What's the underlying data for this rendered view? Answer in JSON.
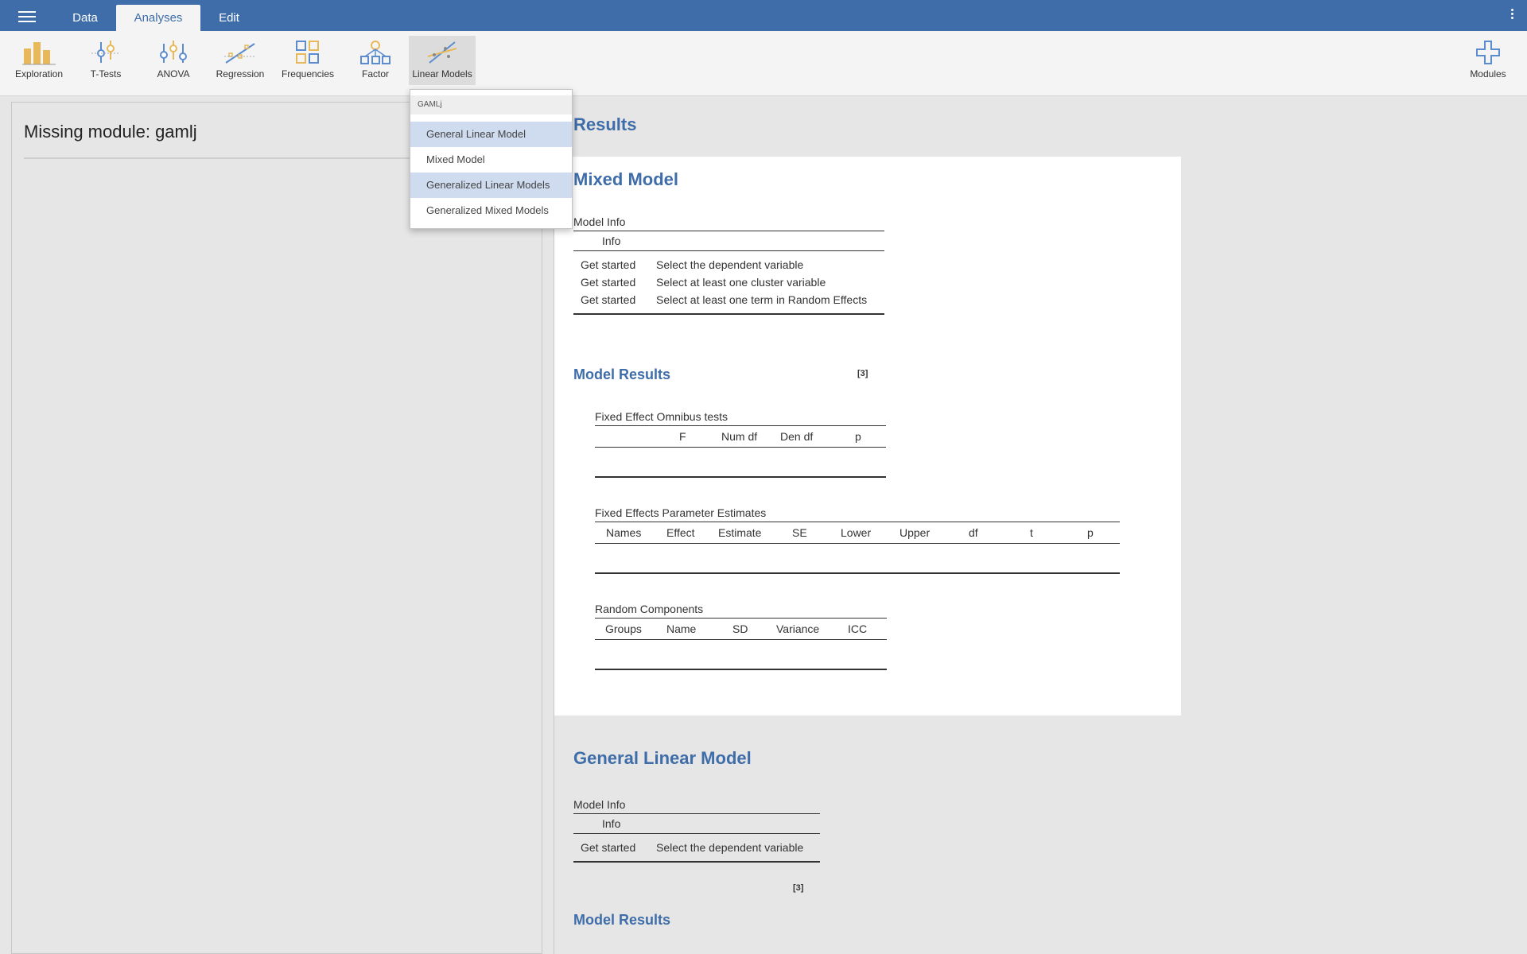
{
  "topbar": {
    "tabs": [
      {
        "label": "Data"
      },
      {
        "label": "Analyses"
      },
      {
        "label": "Edit"
      }
    ],
    "active_tab": "Analyses",
    "color": "#3e6da9"
  },
  "ribbon": {
    "buttons": [
      {
        "label": "Exploration",
        "icon": "exploration-icon"
      },
      {
        "label": "T-Tests",
        "icon": "t-tests-icon"
      },
      {
        "label": "ANOVA",
        "icon": "anova-icon"
      },
      {
        "label": "Regression",
        "icon": "regression-icon"
      },
      {
        "label": "Frequencies",
        "icon": "frequencies-icon"
      },
      {
        "label": "Factor",
        "icon": "factor-icon"
      },
      {
        "label": "Linear Models",
        "icon": "linear-models-icon"
      }
    ],
    "modules_label": "Modules",
    "icon_colors": {
      "yellow": "#e8b95a",
      "blue": "#5b8ccf"
    }
  },
  "dropdown": {
    "group_label": "GAMLj",
    "items": [
      {
        "label": "General Linear Model",
        "highlighted": true
      },
      {
        "label": "Mixed Model",
        "highlighted": false
      },
      {
        "label": "Generalized Linear Models",
        "highlighted": true
      },
      {
        "label": "Generalized Mixed Models",
        "highlighted": false
      }
    ]
  },
  "left_panel": {
    "title": "Missing module: gamlj"
  },
  "results": {
    "heading": "Results",
    "mixed_model": {
      "title": "Mixed Model",
      "model_info": {
        "caption": "Model Info",
        "column": "Info",
        "rows": [
          {
            "a": "Get started",
            "b": "Select the dependent variable"
          },
          {
            "a": "Get started",
            "b": "Select at least one cluster variable"
          },
          {
            "a": "Get started",
            "b": "Select at least one term in Random Effects"
          }
        ],
        "note": "[3]"
      },
      "model_results_title": "Model Results",
      "omnibus": {
        "caption": "Fixed Effect Omnibus tests",
        "columns": [
          "F",
          "Num df",
          "Den df",
          "p"
        ]
      },
      "estimates": {
        "caption": "Fixed Effects Parameter Estimates",
        "columns": [
          "Names",
          "Effect",
          "Estimate",
          "SE",
          "Lower",
          "Upper",
          "df",
          "t",
          "p"
        ]
      },
      "random": {
        "caption": "Random Components",
        "columns": [
          "Groups",
          "Name",
          "SD",
          "Variance",
          "ICC"
        ]
      }
    },
    "glm": {
      "title": "General Linear Model",
      "model_info": {
        "caption": "Model Info",
        "column": "Info",
        "rows": [
          {
            "a": "Get started",
            "b": "Select the dependent variable"
          }
        ],
        "note": "[3]"
      },
      "model_results_title": "Model Results"
    }
  }
}
